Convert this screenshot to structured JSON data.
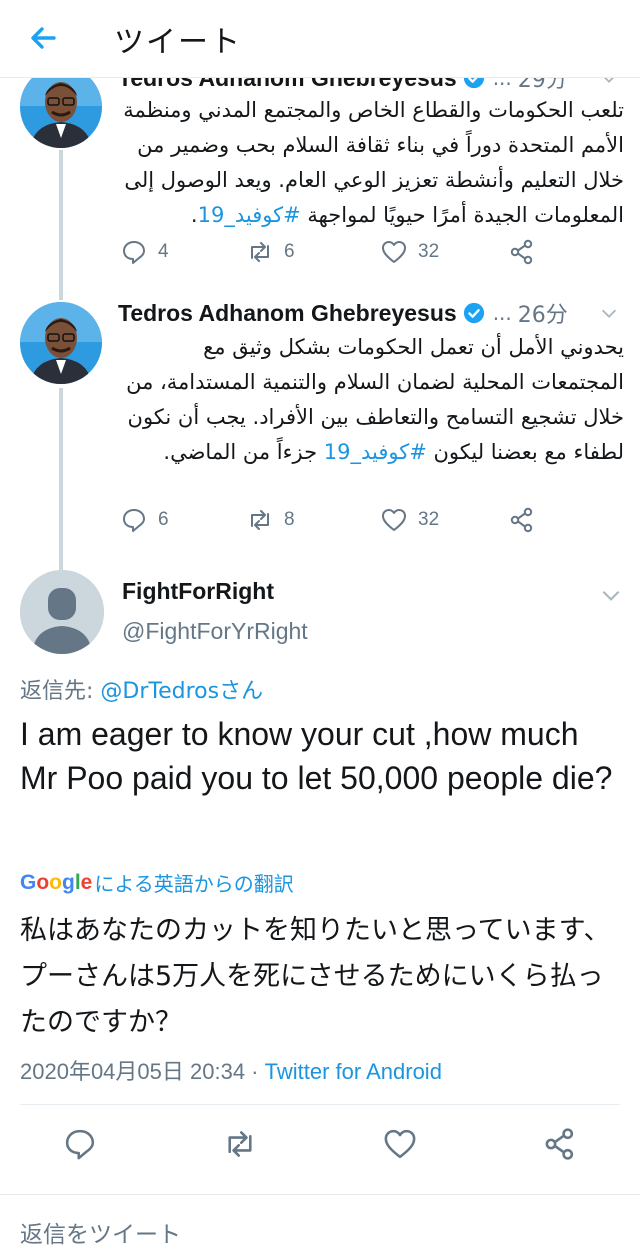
{
  "header": {
    "title": "ツイート"
  },
  "thread": [
    {
      "name": "Tedros Adhanom Ghebreyesus",
      "dots": "...",
      "time": "29分",
      "text_plain": "تلعب الحكومات والقطاع الخاص والمجتمع المدني ومنظمة الأمم المتحدة دوراً في بناء ثقافة السلام بحب وضمير من خلال التعليم وأنشطة تعزيز الوعي العام. ويعد الوصول إلى المعلومات الجيدة أمرًا حيويًا لمواجهة ",
      "hashtag": "#كوفيد_19",
      "text_end": ".",
      "replies": "4",
      "retweets": "6",
      "likes": "32"
    },
    {
      "name": "Tedros Adhanom Ghebreyesus",
      "dots": "...",
      "time": "26分",
      "text_plain": "يحدوني الأمل أن تعمل الحكومات بشكل وثيق مع المجتمعات المحلية لضمان السلام والتنمية المستدامة، من خلال تشجيع التسامح والتعاطف بين الأفراد. يجب أن نكون لطفاء مع بعضنا ليكون ",
      "hashtag": "#كوفيد_19",
      "text_end": " جزءاً من الماضي.",
      "replies": "6",
      "retweets": "8",
      "likes": "32"
    }
  ],
  "main": {
    "name": "FightForRight",
    "handle": "@FightForYrRight",
    "reply_prefix": "返信先: ",
    "reply_mention": "@DrTedrosさん",
    "text": "I am eager to know your cut ,how much Mr Poo paid you to let 50,000 people die?",
    "google_letters": [
      "G",
      "o",
      "o",
      "g",
      "l",
      "e"
    ],
    "google_colors": [
      "#4285f4",
      "#ea4335",
      "#fbbc05",
      "#4285f4",
      "#34a853",
      "#ea4335"
    ],
    "translate_label": "による英語からの翻訳",
    "translation": "私はあなたのカットを知りたいと思っています、プーさんは5万人を死にさせるためにいくら払ったのですか？",
    "timestamp": "2020年04月05日 20:34",
    "separator": " · ",
    "client": "Twitter for Android"
  },
  "reply_bar": {
    "placeholder": "返信をツイート"
  },
  "colors": {
    "accent": "#1b95e0",
    "secondary_text": "#657786",
    "verified": "#1da1f2"
  }
}
